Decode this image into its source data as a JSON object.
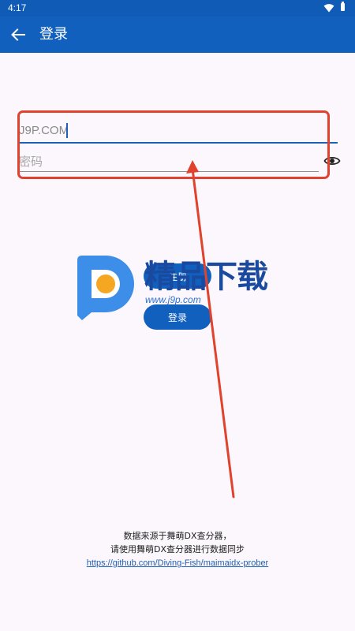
{
  "status_bar": {
    "time": "4:17",
    "icons": [
      "wifi-icon",
      "battery-icon"
    ]
  },
  "app_bar": {
    "back_icon": "arrow-left-icon",
    "title": "登录"
  },
  "form": {
    "username_value": "J9P.COM",
    "password_placeholder": "密码",
    "visibility_icon": "eye-icon"
  },
  "buttons": {
    "register_label": "注册",
    "login_label": "登录"
  },
  "watermark": {
    "brand": "精品下载",
    "url": "www.j9p.com"
  },
  "footer": {
    "line1": "数据来源于舞萌DX查分器，",
    "line2": "请使用舞萌DX查分器进行数据同步",
    "link": "https://github.com/Diving-Fish/maimaidx-prober"
  },
  "colors": {
    "primary": "#1260BE",
    "background": "#FBF7FC",
    "annotation": "#E0422E"
  }
}
